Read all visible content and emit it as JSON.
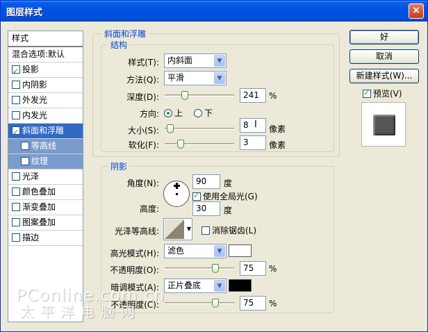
{
  "window": {
    "title": "图层样式",
    "close_label": "×"
  },
  "style_list": {
    "header": "样式",
    "blend_options": "混合选项:默认",
    "items": [
      {
        "label": "投影",
        "checked": true
      },
      {
        "label": "内阴影",
        "checked": false
      },
      {
        "label": "外发光",
        "checked": false
      },
      {
        "label": "内发光",
        "checked": false
      },
      {
        "label": "斜面和浮雕",
        "checked": true
      },
      {
        "label": "等高线",
        "checked": false
      },
      {
        "label": "纹理",
        "checked": false
      },
      {
        "label": "光泽",
        "checked": false
      },
      {
        "label": "颜色叠加",
        "checked": false
      },
      {
        "label": "渐变叠加",
        "checked": false
      },
      {
        "label": "图案叠加",
        "checked": false
      },
      {
        "label": "描边",
        "checked": false
      }
    ]
  },
  "bevel": {
    "group_label": "斜面和浮雕",
    "structure_label": "结构",
    "style_label": "样式(T):",
    "style_value": "内斜面",
    "technique_label": "方法(Q):",
    "technique_value": "平滑",
    "depth_label": "深度(D):",
    "depth_value": "241",
    "depth_unit": "%",
    "depth_level": 0.27,
    "direction_label": "方向:",
    "direction_up": "上",
    "direction_down": "下",
    "size_label": "大小(S):",
    "size_value": "8",
    "size_unit": "像素",
    "size_level": 0.03,
    "soften_label": "软化(F):",
    "soften_value": "3",
    "soften_unit": "像素",
    "soften_level": 0.2
  },
  "shading": {
    "group_label": "阴影",
    "angle_label": "角度(N):",
    "angle_value": "90",
    "angle_unit": "度",
    "global_light_label": "使用全局光(G)",
    "altitude_label": "高度:",
    "altitude_value": "30",
    "altitude_unit": "度",
    "gloss_contour_label": "光泽等高线:",
    "anti_alias_label": "消除锯齿(L)",
    "highlight_mode_label": "高光模式(H):",
    "highlight_mode_value": "滤色",
    "highlight_color": "#ffffff",
    "highlight_opacity_label": "不透明度(O):",
    "highlight_opacity_value": "75",
    "highlight_opacity_unit": "%",
    "highlight_opacity_level": 0.75,
    "shadow_mode_label": "暗调模式(A):",
    "shadow_mode_value": "正片叠底",
    "shadow_color": "#000000",
    "shadow_opacity_label": "不透明度(C):",
    "shadow_opacity_value": "75",
    "shadow_opacity_unit": "%",
    "shadow_opacity_level": 0.75
  },
  "buttons": {
    "ok": "好",
    "cancel": "取消",
    "new_style": "新建样式(W)...",
    "preview": "预览(V)"
  },
  "watermark": {
    "line1": "PConline.com.cn",
    "line2": "太平洋电脑网"
  }
}
